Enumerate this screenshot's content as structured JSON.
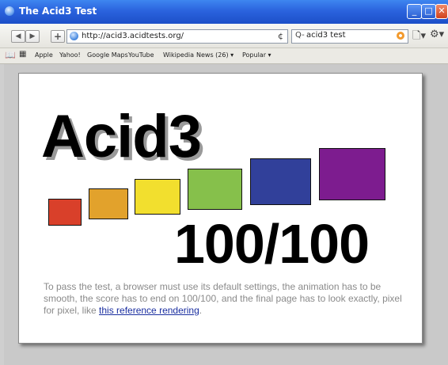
{
  "window": {
    "title": "The Acid3 Test"
  },
  "toolbar": {
    "back_label": "◀",
    "forward_label": "▶",
    "add_label": "+",
    "url": "http://acid3.acidtests.org/",
    "reload_label": "¢",
    "search": {
      "value": "acid3 test",
      "prefix": "Q-"
    },
    "page_menu_label": "🗋▾",
    "settings_menu_label": "⚙▾"
  },
  "bookmarks": {
    "items": [
      {
        "label": "Apple"
      },
      {
        "label": "Yahoo!"
      },
      {
        "label": "Google Maps"
      },
      {
        "label": "YouTube"
      },
      {
        "label": "Wikipedia"
      },
      {
        "label": "News (26) ▾"
      },
      {
        "label": "Popular ▾"
      }
    ]
  },
  "page": {
    "heading": "Acid3",
    "score": "100/100",
    "description_text": "To pass the test, a browser must use its default settings, the animation has to be smooth, the score has to end on 100/100, and the final page has to look exactly, pixel for pixel, like ",
    "link_text": "this reference rendering",
    "description_end": ".",
    "boxes": [
      {
        "color": "#d9402a"
      },
      {
        "color": "#e2a22c"
      },
      {
        "color": "#f2df2e"
      },
      {
        "color": "#86c04b"
      },
      {
        "color": "#31409a"
      },
      {
        "color": "#7d1c8f"
      }
    ]
  }
}
